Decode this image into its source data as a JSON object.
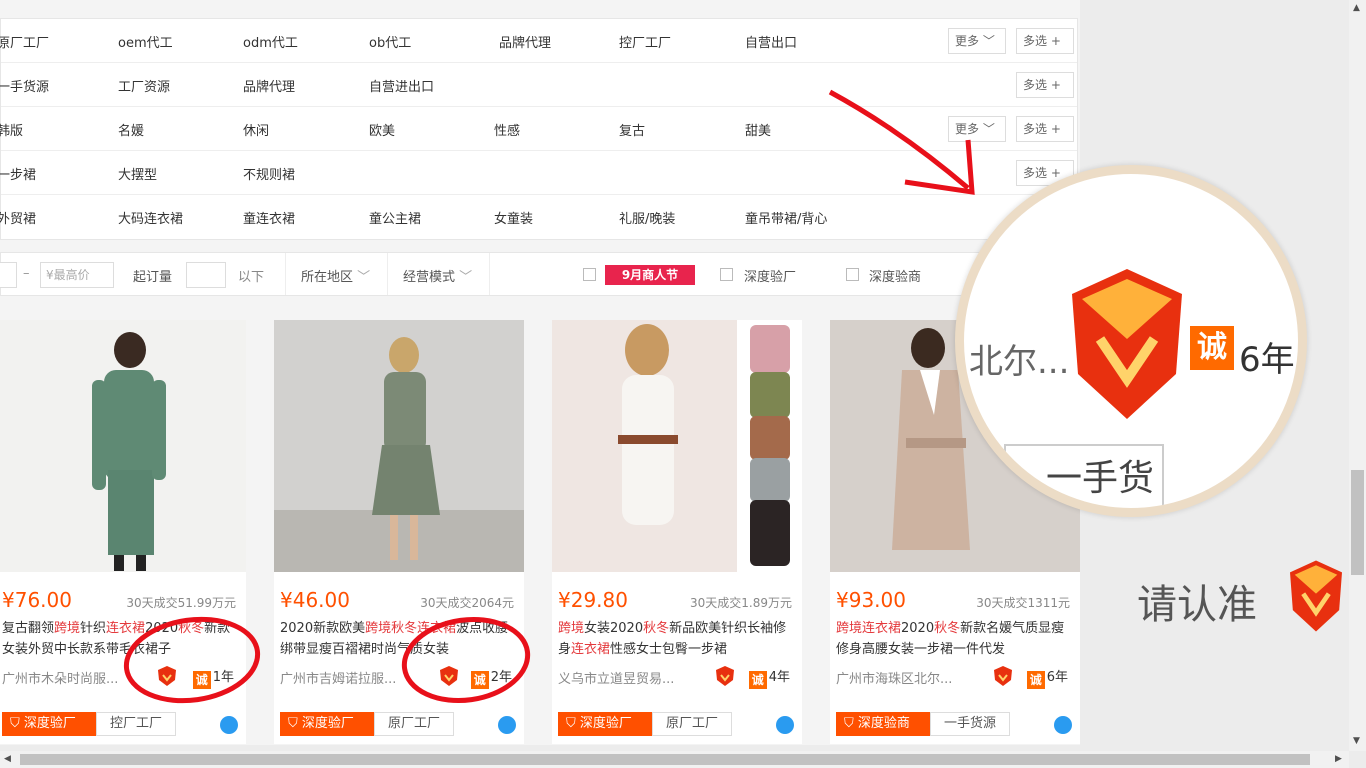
{
  "filters": {
    "rows": [
      {
        "options": [
          "原厂工厂",
          "oem代工",
          "odm代工",
          "ob代工",
          "品牌代理",
          "控厂工厂",
          "自营出口"
        ],
        "more": "更多",
        "multi": "多选"
      },
      {
        "options": [
          "一手货源",
          "工厂资源",
          "品牌代理",
          "自营进出口"
        ],
        "multi": "多选"
      },
      {
        "options": [
          "韩版",
          "名媛",
          "休闲",
          "欧美",
          "性感",
          "复古",
          "甜美"
        ],
        "more": "更多",
        "multi": "多选"
      },
      {
        "options": [
          "一步裙",
          "大摆型",
          "不规则裙"
        ],
        "multi": "多选"
      },
      {
        "options": [
          "外贸裙",
          "大码连衣裙",
          "童连衣裙",
          "童公主裙",
          "女童装",
          "礼服/晚装",
          "童吊带裙/背心"
        ]
      }
    ]
  },
  "toolbar": {
    "max_price_placeholder": "¥最高价",
    "min_order_label": "起订量",
    "below_label": "以下",
    "region_label": "所在地区",
    "mode_label": "经营模式",
    "promo_label": "9月商人节",
    "deep_factory_label": "深度验厂",
    "deep_merchant_label": "深度验商"
  },
  "products": [
    {
      "price": "¥76.00",
      "sold": "30天成交51.99万元",
      "title_parts": [
        "复古翻领",
        "跨境",
        "针织",
        "连衣裙",
        "2020",
        "秋冬",
        "新款女装外贸中长款系带毛衣裙子"
      ],
      "company": "广州市木朵时尚服...",
      "years": "1年",
      "tag1": "深度验厂",
      "tag2": "控厂工厂"
    },
    {
      "price": "¥46.00",
      "sold": "30天成交2064元",
      "title_parts": [
        "2020新款欧美",
        "跨境",
        "",
        "秋冬连衣裙",
        "",
        "",
        "波点收腰绑带显瘦百褶裙时尚气质女装"
      ],
      "company": "广州市吉姆诺拉服...",
      "years": "2年",
      "tag1": "深度验厂",
      "tag2": "原厂工厂"
    },
    {
      "price": "¥29.80",
      "sold": "30天成交1.89万元",
      "title_parts": [
        "",
        "跨境",
        "女装2020",
        "秋冬",
        "新品欧美针织长袖修身",
        "连衣裙",
        "性感女士包臀一步裙"
      ],
      "company": "义乌市立道昱贸易...",
      "years": "4年",
      "tag1": "深度验厂",
      "tag2": "原厂工厂"
    },
    {
      "price": "¥93.00",
      "sold": "30天成交1311元",
      "title_parts": [
        "",
        "跨境连衣裙",
        "2020",
        "秋冬",
        "新款名媛气质显瘦修身高腰女装一步裙一件代发",
        "",
        ""
      ],
      "company": "广州市海珠区北尔...",
      "years": "6年",
      "tag1": "深度验商",
      "tag2": "一手货源"
    }
  ],
  "zoom": {
    "company_fragment": "北尔...",
    "cheng": "诚",
    "years": "6年",
    "source": "一手货源"
  },
  "verify_label": "请认准",
  "icons": {
    "cheng_char": "诚"
  },
  "colors": {
    "accent": "#ff5000",
    "highlight": "#e4393c",
    "annotation": "#e8101a"
  }
}
